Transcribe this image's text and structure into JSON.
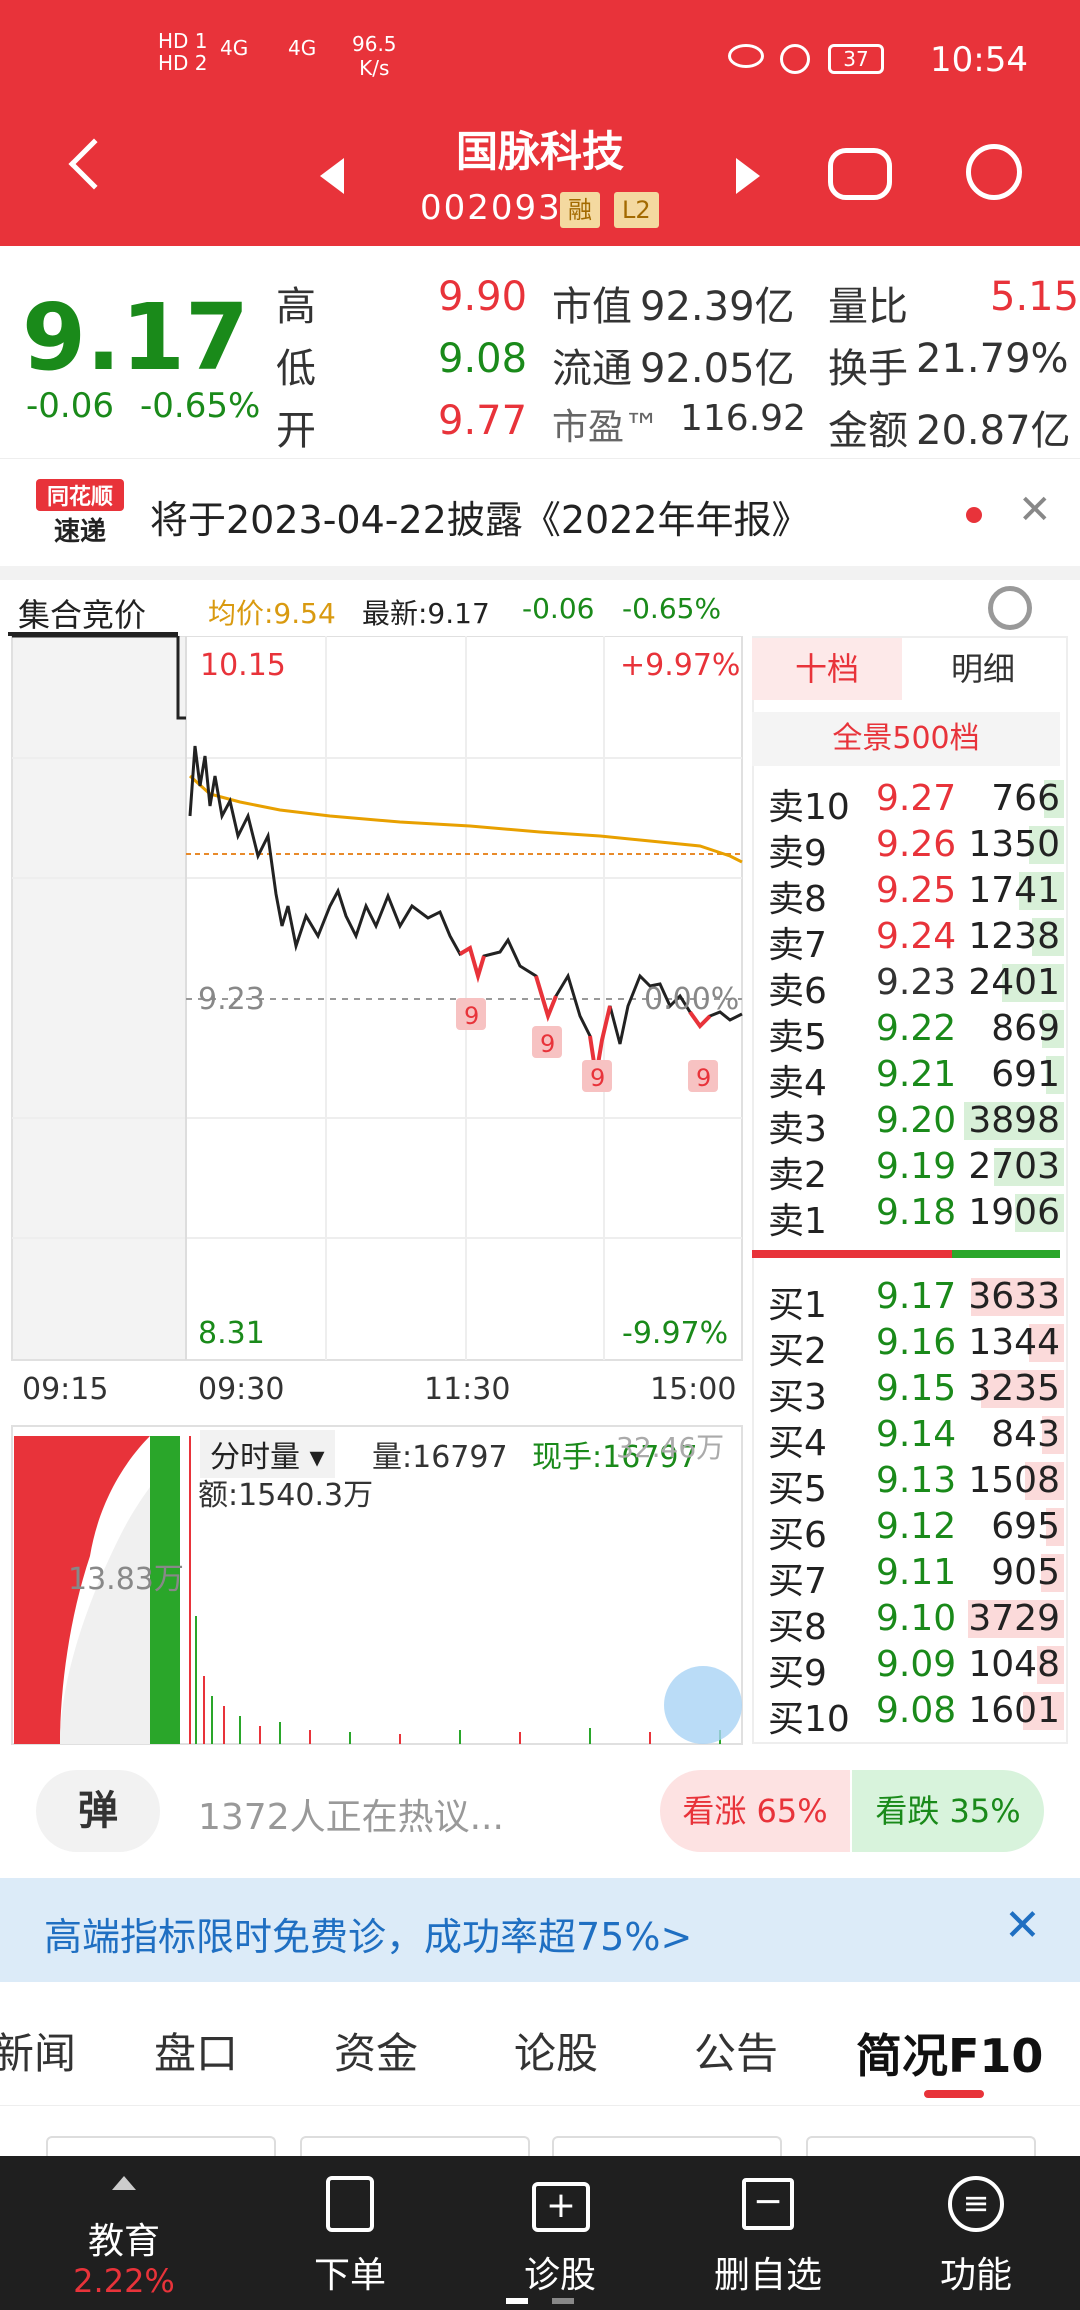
{
  "status": {
    "hd1": "HD 1",
    "hd2": "HD 2",
    "net1": "4G",
    "net2": "4G",
    "speed": "96.5",
    "speed_unit": "K/s",
    "battery": "37",
    "time": "10:54"
  },
  "header": {
    "title": "国脉科技",
    "code": "002093",
    "tag1": "融",
    "tag2": "L2"
  },
  "quote": {
    "price": "9.17",
    "change": "-0.06",
    "change_pct": "-0.65%",
    "high_label": "高",
    "high": "9.90",
    "low_label": "低",
    "low": "9.08",
    "open_label": "开",
    "open": "9.77",
    "mktcap_label": "市值",
    "mktcap": "92.39亿",
    "float_label": "流通",
    "float": "92.05亿",
    "pe_label": "市盈™",
    "pe": "116.92",
    "volratio_label": "量比",
    "volratio": "5.15",
    "turnover_label": "换手",
    "turnover": "21.79%",
    "amount_label": "金额",
    "amount": "20.87亿"
  },
  "notice": {
    "logo1": "同花顺",
    "logo2": "速递",
    "text": "将于2023-04-22披露《2022年年报》"
  },
  "chart": {
    "tab": "集合竞价",
    "avg": "均价:9.54",
    "latest": "最新:9.17",
    "chg": "-0.06",
    "pct": "-0.65%",
    "top_price": "10.15",
    "top_pct": "+9.97%",
    "mid_price": "9.23",
    "mid_pct": "0.00%",
    "bot_price": "8.31",
    "bot_pct": "-9.97%",
    "times": [
      "09:15",
      "09:30",
      "11:30",
      "15:00"
    ],
    "markers": [
      "9",
      "9",
      "9",
      "9"
    ],
    "vol_tab": "分时量",
    "vol": "量:16797",
    "now_hand": "现手:16797",
    "vol_max": "32.46万",
    "vol_amt": "额:1540.3万",
    "auction_vol": "13.83万"
  },
  "orderbook": {
    "tab1": "十档",
    "tab2": "明细",
    "full": "全景500档",
    "asks": [
      {
        "n": "卖10",
        "p": "9.27",
        "v": "766",
        "f": 0.2
      },
      {
        "n": "卖9",
        "p": "9.26",
        "v": "1350",
        "f": 0.35
      },
      {
        "n": "卖8",
        "p": "9.25",
        "v": "1741",
        "f": 0.45
      },
      {
        "n": "卖7",
        "p": "9.24",
        "v": "1238",
        "f": 0.32
      },
      {
        "n": "卖6",
        "p": "9.23",
        "v": "2401",
        "f": 0.62
      },
      {
        "n": "卖5",
        "p": "9.22",
        "v": "869",
        "f": 0.22
      },
      {
        "n": "卖4",
        "p": "9.21",
        "v": "691",
        "f": 0.18
      },
      {
        "n": "卖3",
        "p": "9.20",
        "v": "3898",
        "f": 1.0
      },
      {
        "n": "卖2",
        "p": "9.19",
        "v": "2703",
        "f": 0.7
      },
      {
        "n": "卖1",
        "p": "9.18",
        "v": "1906",
        "f": 0.49
      }
    ],
    "bids": [
      {
        "n": "买1",
        "p": "9.17",
        "v": "3633",
        "f": 0.93
      },
      {
        "n": "买2",
        "p": "9.16",
        "v": "1344",
        "f": 0.35
      },
      {
        "n": "买3",
        "p": "9.15",
        "v": "3235",
        "f": 0.83
      },
      {
        "n": "买4",
        "p": "9.14",
        "v": "843",
        "f": 0.22
      },
      {
        "n": "买5",
        "p": "9.13",
        "v": "1508",
        "f": 0.39
      },
      {
        "n": "买6",
        "p": "9.12",
        "v": "695",
        "f": 0.18
      },
      {
        "n": "买7",
        "p": "9.11",
        "v": "905",
        "f": 0.23
      },
      {
        "n": "买8",
        "p": "9.10",
        "v": "3729",
        "f": 0.96
      },
      {
        "n": "买9",
        "p": "9.09",
        "v": "1048",
        "f": 0.27
      },
      {
        "n": "买10",
        "p": "9.08",
        "v": "1601",
        "f": 0.41
      }
    ]
  },
  "social": {
    "danmu": "弹",
    "discuss": "1372人正在热议...",
    "up": "看涨 65%",
    "down": "看跌 35%"
  },
  "banner": {
    "text": "高端指标限时免费诊，成功率超75%>"
  },
  "tabs": [
    "新闻",
    "盘口",
    "资金",
    "论股",
    "公告",
    "简况F10"
  ],
  "bottom": [
    {
      "label": "教育",
      "sub": "2.22%"
    },
    {
      "label": "下单"
    },
    {
      "label": "诊股"
    },
    {
      "label": "删自选"
    },
    {
      "label": "功能"
    }
  ]
}
